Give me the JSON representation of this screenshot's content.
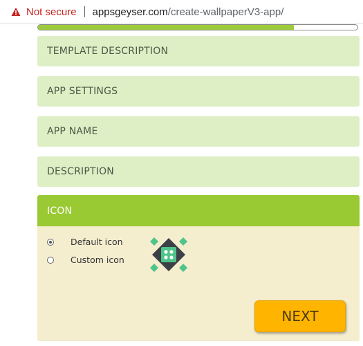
{
  "browser": {
    "security_label": "Not secure",
    "url_host": "appsgeyser.com",
    "url_path": "/create-wallpaperV3-app/"
  },
  "progress": {
    "fraction": 0.8
  },
  "sections": [
    {
      "label": "TEMPLATE DESCRIPTION"
    },
    {
      "label": "APP SETTINGS"
    },
    {
      "label": "APP NAME"
    },
    {
      "label": "DESCRIPTION"
    }
  ],
  "icon_section": {
    "title": "ICON",
    "options": [
      {
        "label": "Default icon",
        "selected": true
      },
      {
        "label": "Custom icon",
        "selected": false
      }
    ],
    "next_label": "NEXT"
  },
  "colors": {
    "accent_green": "#99c933",
    "section_bg": "#deefc6",
    "panel_bg": "#f4edce",
    "button": "#ffb400",
    "warning": "#c5221f"
  }
}
